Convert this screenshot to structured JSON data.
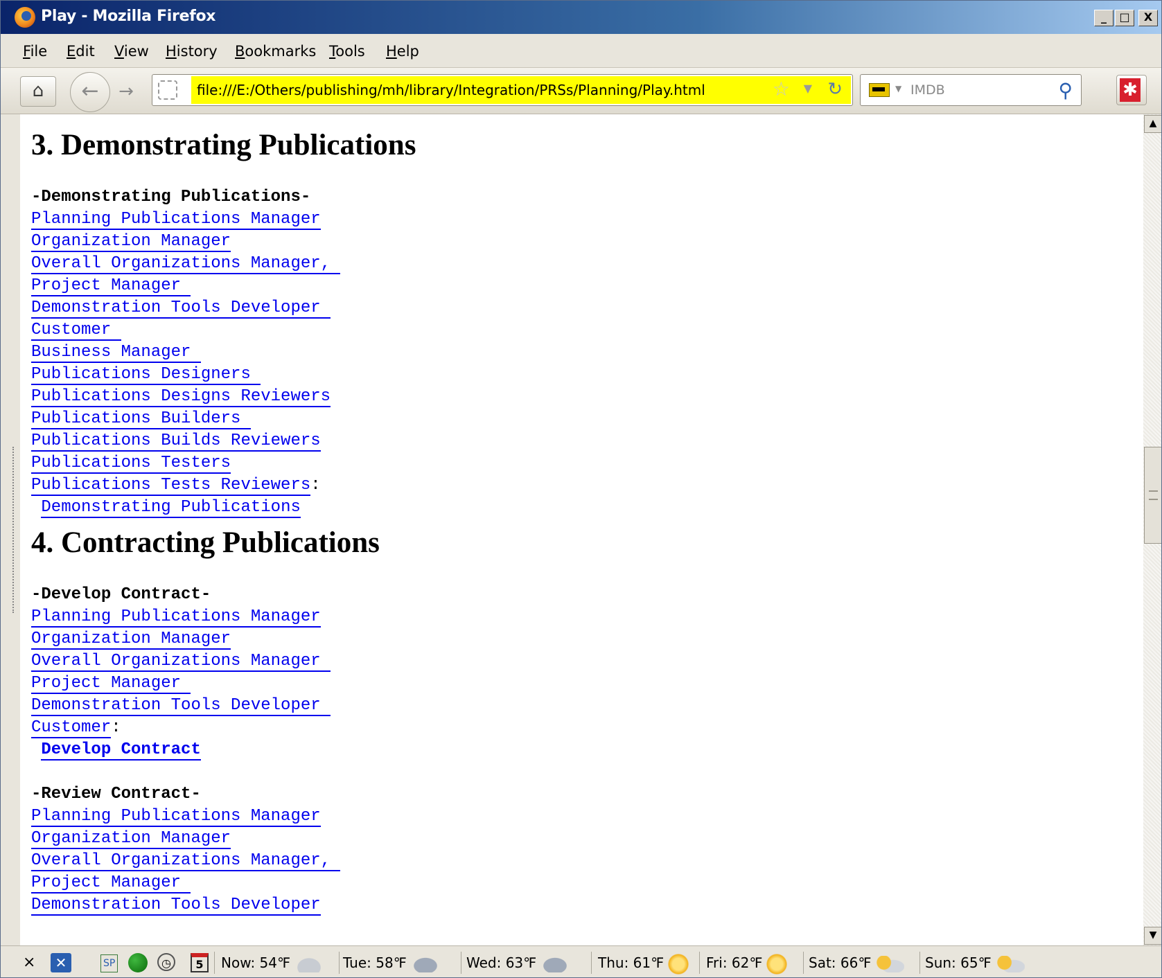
{
  "window": {
    "title": "Play - Mozilla Firefox",
    "controls": {
      "minimize": "_",
      "maximize": "□",
      "close": "X"
    }
  },
  "menu": [
    "File",
    "Edit",
    "View",
    "History",
    "Bookmarks",
    "Tools",
    "Help"
  ],
  "navbar": {
    "url": "file:///E:/Others/publishing/mh/library/Integration/PRSs/Planning/Play.html",
    "url_highlight_color": "#ffff00",
    "search_engine": "IMDB"
  },
  "sections": [
    {
      "heading": "3. Demonstrating Publications",
      "blocks": [
        {
          "header": "-Demonstrating Publications-",
          "roles": [
            "Planning Publications Manager",
            "Organization Manager",
            "Overall Organizations Manager, ",
            "Project Manager ",
            "Demonstration Tools Developer ",
            "Customer ",
            "Business Manager ",
            "Publications Designers ",
            "Publications Designs Reviewers",
            "Publications Builders ",
            "Publications Builds Reviewers",
            "Publications Testers",
            "Publications Tests Reviewers"
          ],
          "suffix": ":",
          "activity": "Demonstrating Publications"
        }
      ]
    },
    {
      "heading": "4. Contracting Publications",
      "blocks": [
        {
          "header": "-Develop Contract-",
          "roles": [
            "Planning Publications Manager",
            "Organization Manager",
            "Overall Organizations Manager ",
            "Project Manager ",
            "Demonstration Tools Developer ",
            "Customer"
          ],
          "suffix": ":",
          "activity": "Develop Contract"
        },
        {
          "header": "-Review Contract-",
          "roles": [
            "Planning Publications Manager",
            "Organization Manager",
            "Overall Organizations Manager, ",
            "Project Manager ",
            "Demonstration Tools Developer"
          ],
          "suffix": "",
          "activity": ""
        }
      ]
    }
  ],
  "statusbar": {
    "weather": [
      {
        "label": "Now: 54℉",
        "icon": "cloud-icon"
      },
      {
        "label": "Tue: 58℉",
        "icon": "rain-cloud-icon"
      },
      {
        "label": "Wed: 63℉",
        "icon": "rain-cloud-icon"
      },
      {
        "label": "Thu: 61℉",
        "icon": "sun-icon"
      },
      {
        "label": "Fri: 62℉",
        "icon": "sun-icon"
      },
      {
        "label": "Sat: 66℉",
        "icon": "partly-cloudy-icon"
      },
      {
        "label": "Sun: 65℉",
        "icon": "partly-cloudy-icon"
      }
    ],
    "calendar_day": "5",
    "sp_label": "SP",
    "close_glyph": "×"
  }
}
